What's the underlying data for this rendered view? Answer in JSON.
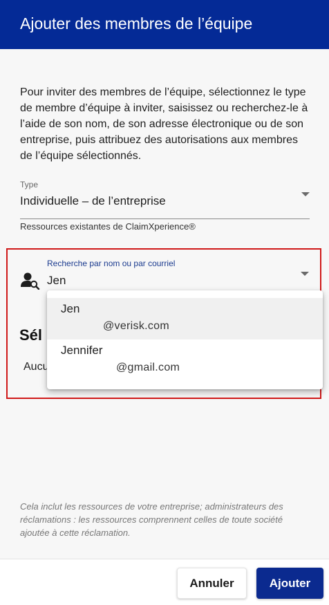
{
  "dialog": {
    "title": "Ajouter des membres de l’équipe"
  },
  "intro": "Pour inviter des membres de l’équipe, sélectionnez le type de membre d’équipe à inviter, saisissez ou recherchez-le à l’aide de son nom, de son adresse électronique ou de son entreprise, puis attribuez des autorisations aux membres de l’équipe sélectionnés.",
  "type_field": {
    "label": "Type",
    "value": "Individuelle – de l’entreprise",
    "helper": "Ressources existantes de ClaimXperience®"
  },
  "search": {
    "label": "Recherche par nom ou par courriel",
    "value": "Jen"
  },
  "suggestions": [
    {
      "name": "Jen",
      "email": "@verisk.com"
    },
    {
      "name": "Jennifer",
      "email": "@gmail.com"
    }
  ],
  "selected_section": {
    "heading_visible": "Sél",
    "empty_visible": "Aucu"
  },
  "footnote": "Cela inclut les ressources de votre entreprise; administrateurs des réclamations : les ressources comprennent celles de toute société ajoutée à cette réclamation.",
  "footer": {
    "cancel_label": "Annuler",
    "add_label": "Ajouter"
  },
  "colors": {
    "header_bg": "#042a96",
    "primary_button": "#0b2a8f",
    "highlight_border": "#d01818"
  }
}
